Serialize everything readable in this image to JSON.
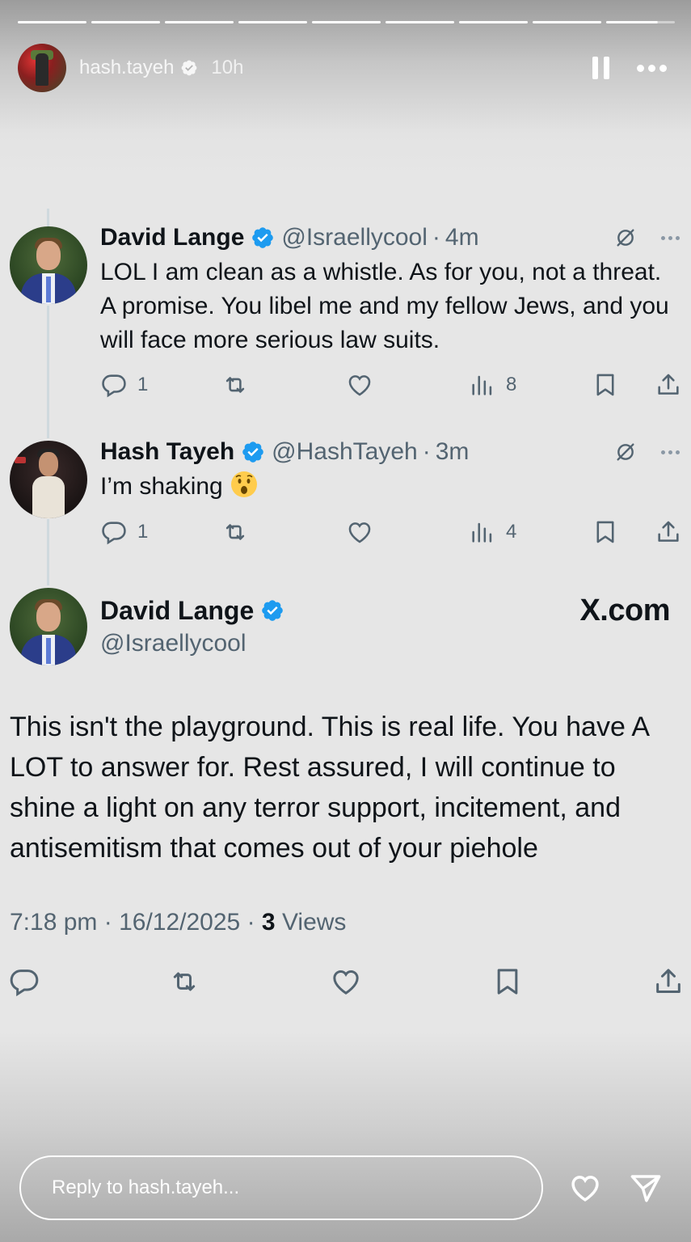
{
  "story": {
    "username": "hash.tayeh",
    "time_ago": "10h",
    "segments": 9,
    "reply_placeholder": "Reply to hash.tayeh...",
    "icons": [
      "verified-icon",
      "pause-icon",
      "more-icon",
      "heart-icon",
      "send-icon"
    ]
  },
  "tweets": [
    {
      "name": "David Lange",
      "handle": "@Israellycool",
      "age": "4m",
      "text": "LOL I am clean as a whistle. As for you, not a threat. A promise. You libel me and my fellow Jews, and you will face more serious law suits.",
      "replies": "1",
      "views": "8"
    },
    {
      "name": "Hash Tayeh",
      "handle": "@HashTayeh",
      "age": "3m",
      "text": "I’m shaking",
      "emoji": "hushed-face-emoji",
      "replies": "1",
      "views": "4"
    }
  ],
  "main_tweet": {
    "name": "David Lange",
    "handle": "@Israellycool",
    "brand": "X.com",
    "text": "This isn't the playground. This is real life. You have A LOT to answer for. Rest assured, I will continue to shine a light on any terror support, incitement, and antisemitism that comes out of your piehole",
    "time": "7:18 pm",
    "date": "16/12/2025",
    "views_count": "3",
    "views_label": "Views"
  },
  "colors": {
    "verified": "#1d9bf0",
    "secondary_text": "#536471",
    "primary_text": "#0f1419",
    "background": "#e6e6e6"
  }
}
